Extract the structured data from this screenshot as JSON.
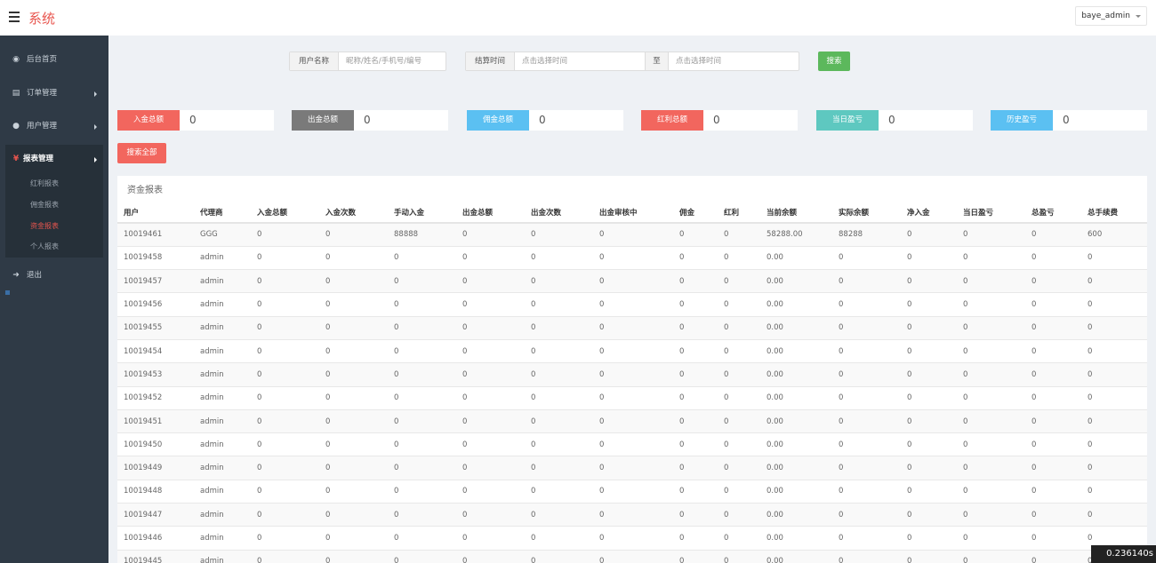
{
  "app": {
    "title": "系统",
    "user": "baye_admin"
  },
  "sidebar": {
    "items": [
      {
        "label": "后台首页",
        "icon": "dashboard-icon"
      },
      {
        "label": "订单管理",
        "icon": "file-icon"
      },
      {
        "label": "用户管理",
        "icon": "user-icon"
      },
      {
        "label": "报表管理",
        "icon": "yen-icon"
      },
      {
        "label": "退出",
        "icon": "logout-icon"
      }
    ],
    "subitems": [
      "红利报表",
      "佣金报表",
      "资金报表",
      "个人报表"
    ]
  },
  "search": {
    "user_label": "用户名称",
    "user_placeholder": "昵称/姓名/手机号/编号",
    "time_label": "结算时间",
    "time_start_placeholder": "点击选择时间",
    "to_label": "至",
    "time_end_placeholder": "点击选择时间",
    "button": "搜索"
  },
  "stats": [
    {
      "label": "入金总额",
      "value": "0",
      "color": "#f2665e"
    },
    {
      "label": "出金总额",
      "value": "0",
      "color": "#7a7a7a"
    },
    {
      "label": "佣金总额",
      "value": "0",
      "color": "#5bc0f2"
    },
    {
      "label": "红利总额",
      "value": "0",
      "color": "#f2665e"
    },
    {
      "label": "当日盈亏",
      "value": "0",
      "color": "#5ec8c0"
    },
    {
      "label": "历史盈亏",
      "value": "0",
      "color": "#5bc0f2"
    }
  ],
  "search_all_button": "搜索全部",
  "report": {
    "title": "资金报表",
    "headers": [
      "用户",
      "代理商",
      "入金总额",
      "入金次数",
      "手动入金",
      "出金总额",
      "出金次数",
      "出金审核中",
      "佣金",
      "红利",
      "当前余额",
      "实际余额",
      "净入金",
      "当日盈亏",
      "总盈亏",
      "总手续费"
    ],
    "rows": [
      [
        "10019461",
        "GGG",
        "0",
        "0",
        "88888",
        "0",
        "0",
        "0",
        "0",
        "0",
        "58288.00",
        "88288",
        "0",
        "0",
        "0",
        "600"
      ],
      [
        "10019458",
        "admin",
        "0",
        "0",
        "0",
        "0",
        "0",
        "0",
        "0",
        "0",
        "0.00",
        "0",
        "0",
        "0",
        "0",
        "0"
      ],
      [
        "10019457",
        "admin",
        "0",
        "0",
        "0",
        "0",
        "0",
        "0",
        "0",
        "0",
        "0.00",
        "0",
        "0",
        "0",
        "0",
        "0"
      ],
      [
        "10019456",
        "admin",
        "0",
        "0",
        "0",
        "0",
        "0",
        "0",
        "0",
        "0",
        "0.00",
        "0",
        "0",
        "0",
        "0",
        "0"
      ],
      [
        "10019455",
        "admin",
        "0",
        "0",
        "0",
        "0",
        "0",
        "0",
        "0",
        "0",
        "0.00",
        "0",
        "0",
        "0",
        "0",
        "0"
      ],
      [
        "10019454",
        "admin",
        "0",
        "0",
        "0",
        "0",
        "0",
        "0",
        "0",
        "0",
        "0.00",
        "0",
        "0",
        "0",
        "0",
        "0"
      ],
      [
        "10019453",
        "admin",
        "0",
        "0",
        "0",
        "0",
        "0",
        "0",
        "0",
        "0",
        "0.00",
        "0",
        "0",
        "0",
        "0",
        "0"
      ],
      [
        "10019452",
        "admin",
        "0",
        "0",
        "0",
        "0",
        "0",
        "0",
        "0",
        "0",
        "0.00",
        "0",
        "0",
        "0",
        "0",
        "0"
      ],
      [
        "10019451",
        "admin",
        "0",
        "0",
        "0",
        "0",
        "0",
        "0",
        "0",
        "0",
        "0.00",
        "0",
        "0",
        "0",
        "0",
        "0"
      ],
      [
        "10019450",
        "admin",
        "0",
        "0",
        "0",
        "0",
        "0",
        "0",
        "0",
        "0",
        "0.00",
        "0",
        "0",
        "0",
        "0",
        "0"
      ],
      [
        "10019449",
        "admin",
        "0",
        "0",
        "0",
        "0",
        "0",
        "0",
        "0",
        "0",
        "0.00",
        "0",
        "0",
        "0",
        "0",
        "0"
      ],
      [
        "10019448",
        "admin",
        "0",
        "0",
        "0",
        "0",
        "0",
        "0",
        "0",
        "0",
        "0.00",
        "0",
        "0",
        "0",
        "0",
        "0"
      ],
      [
        "10019447",
        "admin",
        "0",
        "0",
        "0",
        "0",
        "0",
        "0",
        "0",
        "0",
        "0.00",
        "0",
        "0",
        "0",
        "0",
        "0"
      ],
      [
        "10019446",
        "admin",
        "0",
        "0",
        "0",
        "0",
        "0",
        "0",
        "0",
        "0",
        "0.00",
        "0",
        "0",
        "0",
        "0",
        "0"
      ],
      [
        "10019445",
        "admin",
        "0",
        "0",
        "0",
        "0",
        "0",
        "0",
        "0",
        "0",
        "0.00",
        "0",
        "0",
        "0",
        "0",
        "0"
      ]
    ]
  },
  "timer": "0.236140s"
}
